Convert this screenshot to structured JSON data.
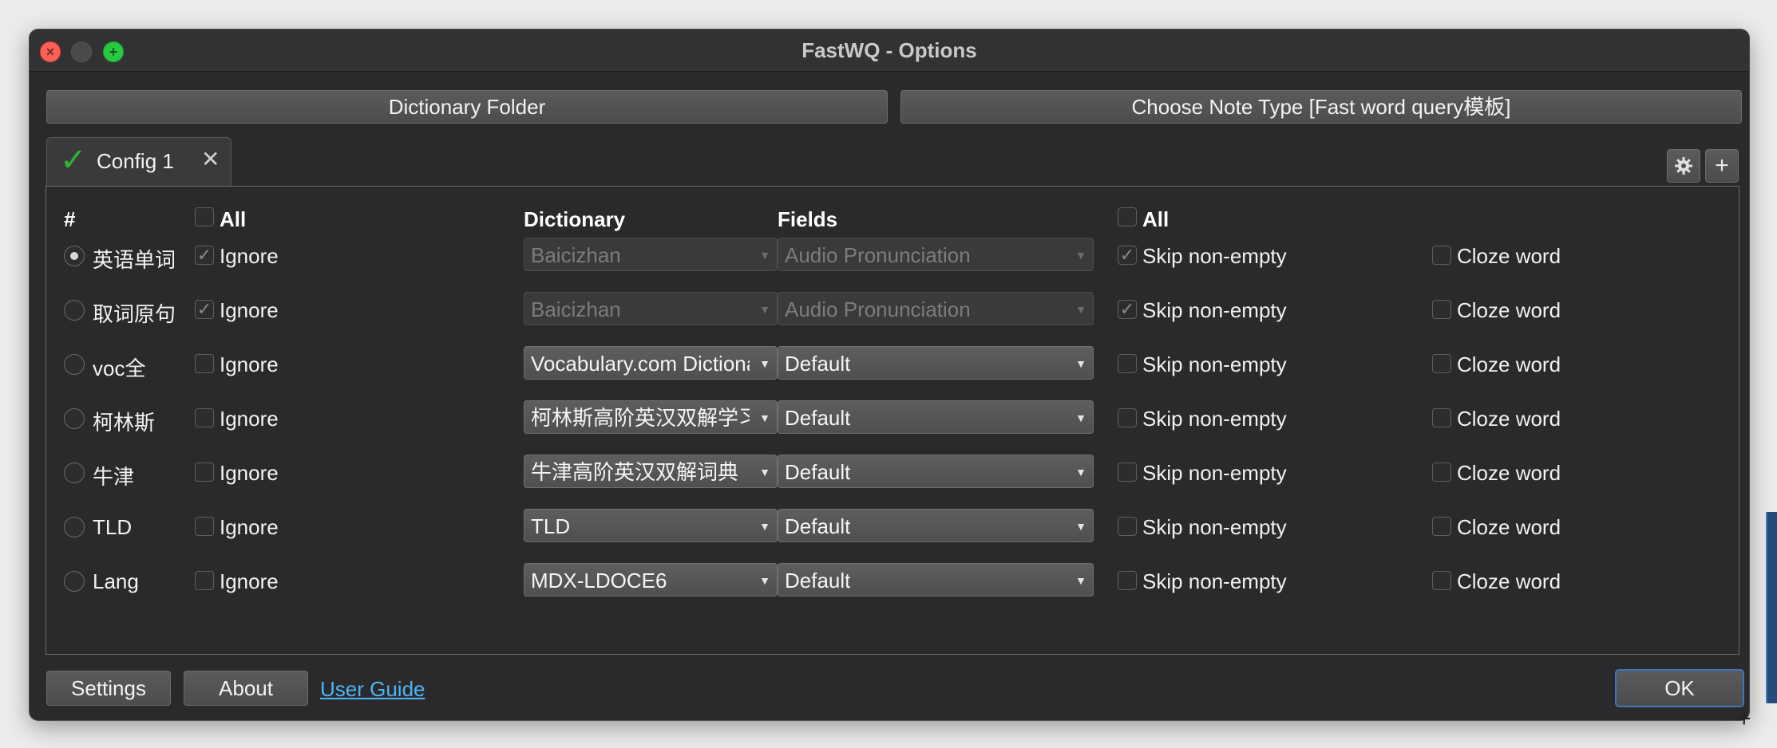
{
  "window": {
    "title": "FastWQ - Options"
  },
  "toolbar": {
    "dictionary_folder": "Dictionary Folder",
    "choose_note_type": "Choose Note Type [Fast word query模板]"
  },
  "tab": {
    "label": "Config 1",
    "check_glyph": "✓",
    "close_glyph": "✕"
  },
  "header": {
    "hash": "#",
    "all_left": "All",
    "dictionary": "Dictionary",
    "fields": "Fields",
    "all_right": "All"
  },
  "rows": [
    {
      "name": "英语单词",
      "selected": true,
      "ignore_checked": true,
      "dictionary": "Baicizhan",
      "field": "Audio Pronunciation",
      "skip_checked": true,
      "enabled": false
    },
    {
      "name": "取词原句",
      "selected": false,
      "ignore_checked": true,
      "dictionary": "Baicizhan",
      "field": "Audio Pronunciation",
      "skip_checked": true,
      "enabled": false
    },
    {
      "name": "voc全",
      "selected": false,
      "ignore_checked": false,
      "dictionary": "Vocabulary.com Dictionary",
      "field": "Default",
      "skip_checked": false,
      "enabled": true
    },
    {
      "name": "柯林斯",
      "selected": false,
      "ignore_checked": false,
      "dictionary": "柯林斯高阶英汉双解学习词典",
      "field": "Default",
      "skip_checked": false,
      "enabled": true
    },
    {
      "name": "牛津",
      "selected": false,
      "ignore_checked": false,
      "dictionary": "牛津高阶英汉双解词典",
      "field": "Default",
      "skip_checked": false,
      "enabled": true
    },
    {
      "name": "TLD",
      "selected": false,
      "ignore_checked": false,
      "dictionary": "TLD",
      "field": "Default",
      "skip_checked": false,
      "enabled": true
    },
    {
      "name": "Lang",
      "selected": false,
      "ignore_checked": false,
      "dictionary": "MDX-LDOCE6",
      "field": "Default",
      "skip_checked": false,
      "enabled": true
    }
  ],
  "labels": {
    "ignore": "Ignore",
    "skip": "Skip non-empty",
    "cloze": "Cloze word"
  },
  "bottom": {
    "settings": "Settings",
    "about": "About",
    "user_guide": "User Guide",
    "ok": "OK"
  },
  "icons": {
    "gear": "gear-icon",
    "plus": "plus-icon"
  },
  "colors": {
    "accent_link": "#4fb4f2",
    "check_green": "#2fb52f",
    "ok_border": "#3a76b9"
  }
}
